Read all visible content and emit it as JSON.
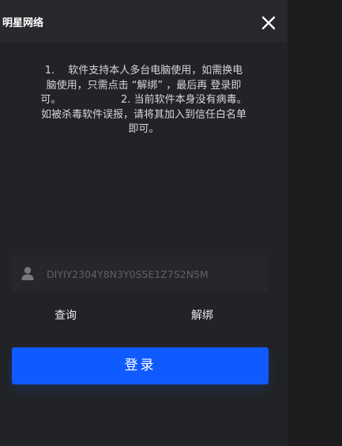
{
  "window": {
    "title": "明星网络",
    "close_icon": "close-icon"
  },
  "notice": {
    "text": "1.　 软件支持本人多台电脑使用，如需换电\n脑使用，只需点击 “解绑” ，最后再 登录即\n可。　　　　　　 2. 当前软件本身没有病毒。\n如被杀毒软件误报，请将其加入到信任白名单\n即可。"
  },
  "license": {
    "icon": "user-icon",
    "value": "DIYIY2304Y8N3Y0S5E1Z7S2N5M",
    "placeholder": ""
  },
  "actions": {
    "query_label": "查询",
    "unbind_label": "解绑",
    "login_label": "登录"
  },
  "colors": {
    "accent": "#0f5bff",
    "background": "#222326",
    "titlebar": "#28292d",
    "field": "#26272b"
  }
}
